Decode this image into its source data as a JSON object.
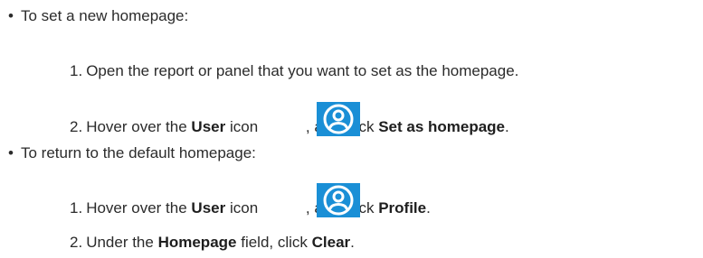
{
  "bullets": [
    {
      "text": "To set a new homepage:",
      "steps": [
        {
          "number": "1.",
          "text": "Open the report or panel that you want to set as the homepage."
        },
        {
          "number": "2.",
          "pre": "Hover over the ",
          "bold1": "User",
          "mid": " icon ",
          "post": ", and click ",
          "bold2": "Set as homepage",
          "end": "."
        }
      ]
    },
    {
      "text": "To return to the default homepage:",
      "steps": [
        {
          "number": "1.",
          "pre": "Hover over the ",
          "bold1": "User",
          "mid": " icon ",
          "post": ", and click ",
          "bold2": "Profile",
          "end": "."
        },
        {
          "number": "2.",
          "pre": "Under the ",
          "bold1": "Homepage",
          "mid": " field, click ",
          "bold2": "Clear",
          "end": "."
        }
      ]
    }
  ],
  "bullet_char": "•",
  "icon": {
    "name": "user-icon",
    "color": "#1a8fd6"
  }
}
